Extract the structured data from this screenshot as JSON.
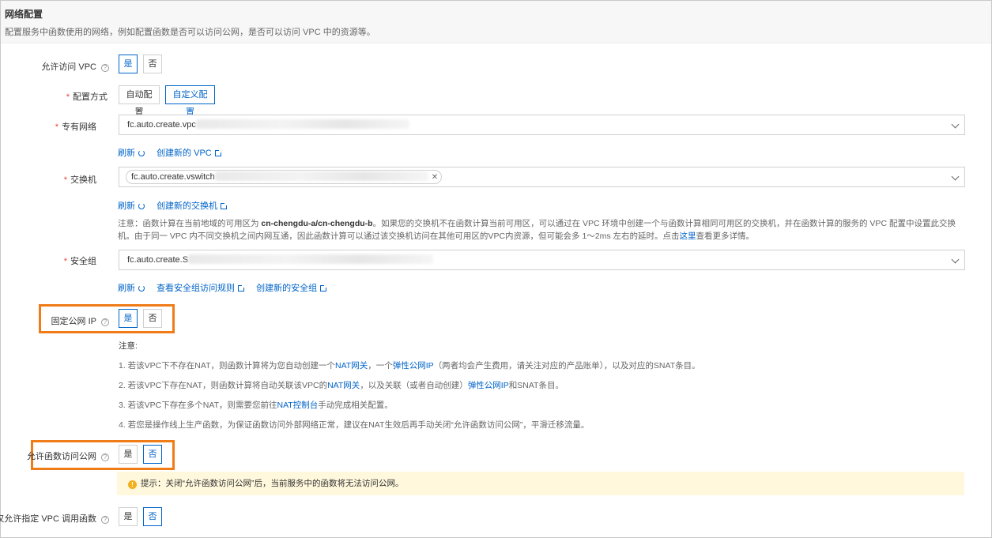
{
  "header": {
    "title": "网络配置",
    "desc": "配置服务中函数使用的网络，例如配置函数是否可以访问公网，是否可以访问 VPC 中的资源等。"
  },
  "allow_vpc": {
    "label": "允许访问 VPC",
    "yes": "是",
    "no": "否",
    "selected": "是"
  },
  "config_mode": {
    "label": "配置方式",
    "auto": "自动配置",
    "custom": "自定义配置",
    "selected": "自定义配置"
  },
  "vpc": {
    "label": "专有网络",
    "value": "fc.auto.create.vpc",
    "refresh": "刷新",
    "create": "创建新的 VPC"
  },
  "vswitch": {
    "label": "交换机",
    "tag_value": "fc.auto.create.vswitch",
    "refresh": "刷新",
    "create": "创建新的交换机",
    "note_1": "注意：函数计算在当前地域的可用区为 ",
    "note_zones": "cn-chengdu-a/cn-chengdu-b",
    "note_2": "。如果您的交换机不在函数计算当前可用区，可以通过在 VPC 环境中创建一个与函数计算相同可用区的交换机，并在函数计算的服务的 VPC 配置中设置此交换机。由于同一 VPC 内不",
    "note_3": "同交换机之间内网互通，因此函数计算可以通过该交换机访问在其他可用区的VPC内资源，但可能会多 1～2ms 左右的延时。点击",
    "note_link": "这里",
    "note_4": "查看更多详情。"
  },
  "security_group": {
    "label": "安全组",
    "value": "fc.auto.create.S",
    "refresh": "刷新",
    "view_rules": "查看安全组访问规则",
    "create": "创建新的安全组"
  },
  "fixed_ip": {
    "label": "固定公网 IP",
    "yes": "是",
    "no": "否",
    "selected": "是",
    "note_title": "注意:",
    "notes": [
      {
        "pre": "1. 若该VPC下不存在NAT，则函数计算将为您自动创建一个",
        "l1": "NAT网关",
        "mid": "，一个",
        "l2": "弹性公网IP",
        "post": "（两者均会产生费用，请关注对应的产品账单），以及对应的SNAT条目。"
      },
      {
        "pre": "2. 若该VPC下存在NAT，则函数计算将自动关联该VPC的",
        "l1": "NAT网关",
        "mid": "，以及关联（或者自动创建）",
        "l2": "弹性公网IP",
        "post": "和SNAT条目。"
      },
      {
        "pre": "3. 若该VPC下存在多个NAT，则需要您前往",
        "l1": "NAT控制台",
        "mid": "手动完成相关配置。",
        "l2": "",
        "post": ""
      },
      {
        "pre": "4. 若您是操作线上生产函数，为保证函数访问外部网络正常，建议在NAT生效后再手动关闭“允许函数访问公网”，平滑迁移流量。",
        "l1": "",
        "mid": "",
        "l2": "",
        "post": ""
      }
    ]
  },
  "internet_access": {
    "label": "允许函数访问公网",
    "yes": "是",
    "no": "否",
    "selected": "否",
    "tip": "提示：关闭“允许函数访问公网”后，当前服务中的函数将无法访问公网。"
  },
  "vpc_only": {
    "label": "仅允许指定 VPC 调用函数",
    "yes": "是",
    "no": "否",
    "selected": "否"
  },
  "colors": {
    "primary": "#0064c8",
    "highlight": "#f07c18",
    "tip_bg": "#fff8dc",
    "required": "#e84738"
  },
  "icons": {
    "help": "question-circle-icon",
    "refresh": "refresh-icon",
    "external": "external-link-icon",
    "warning": "warning-icon",
    "dropdown": "chevron-down-icon",
    "remove": "close-icon"
  }
}
